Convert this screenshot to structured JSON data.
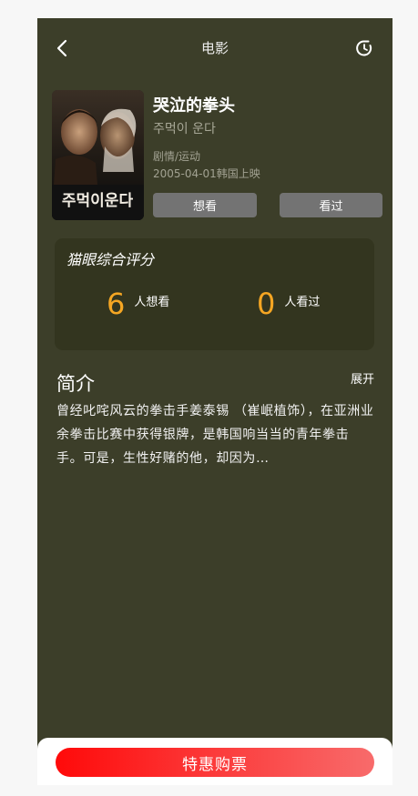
{
  "nav": {
    "title": "电影",
    "back_icon": "chevron-left-icon",
    "share_icon": "refresh-icon"
  },
  "movie": {
    "title": "哭泣的拳头",
    "subtitle": "주먹이 운다",
    "genre": "剧情/运动",
    "release": "2005-04-01韩国上映",
    "poster_text": "주먹이운다"
  },
  "actions": {
    "want_label": "想看",
    "seen_label": "看过"
  },
  "rating": {
    "title": "猫眼综合评分",
    "want_count": "6",
    "want_label": "人想看",
    "seen_count": "0",
    "seen_label": "人看过"
  },
  "synopsis": {
    "heading": "简介",
    "toggle": "展开",
    "text": "曾经叱咤风云的拳击手姜泰锡 （崔岷植饰），在亚洲业余拳击比赛中获得银牌，是韩国响当当的青年拳击手。可是，生性好赌的他，却因为…"
  },
  "footer": {
    "buy_label": "特惠购票"
  },
  "colors": {
    "background": "#3c3e29",
    "card": "#33351f",
    "accent": "#f5a623",
    "buy_start": "#ff0a0a",
    "buy_end": "#f86b6b"
  }
}
